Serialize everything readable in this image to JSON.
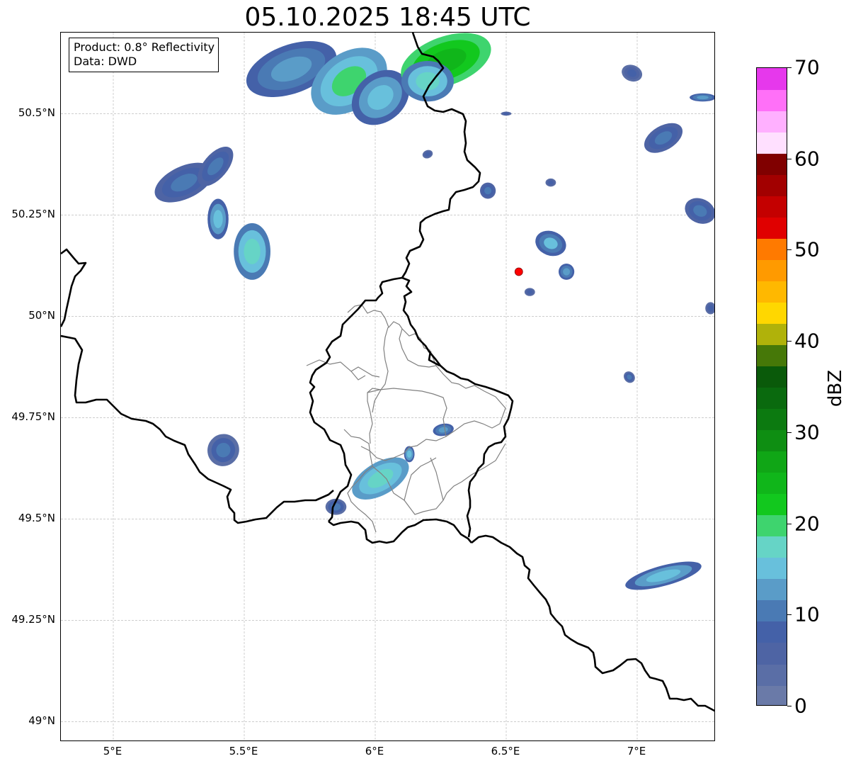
{
  "title": "05.10.2025 18:45 UTC",
  "info": {
    "line1": "Product: 0.8° Reflectivity",
    "line2": "Data: DWD"
  },
  "axes": {
    "x_ticks": [
      {
        "value": 5.0,
        "label": "5°E"
      },
      {
        "value": 5.5,
        "label": "5.5°E"
      },
      {
        "value": 6.0,
        "label": "6°E"
      },
      {
        "value": 6.5,
        "label": "6.5°E"
      },
      {
        "value": 7.0,
        "label": "7°E"
      }
    ],
    "y_ticks": [
      {
        "value": 50.5,
        "label": "50.5°N"
      },
      {
        "value": 50.25,
        "label": "50.25°N"
      },
      {
        "value": 50.0,
        "label": "50°N"
      },
      {
        "value": 49.75,
        "label": "49.75°N"
      },
      {
        "value": 49.5,
        "label": "49.5°N"
      },
      {
        "value": 49.25,
        "label": "49.25°N"
      },
      {
        "value": 49.0,
        "label": "49°N"
      }
    ],
    "lon_range": [
      4.8,
      7.3
    ],
    "lat_range": [
      48.95,
      50.7
    ]
  },
  "colorbar": {
    "label": "dBZ",
    "min": 0,
    "max": 70,
    "ticks": [
      "0",
      "10",
      "20",
      "30",
      "40",
      "50",
      "60",
      "70"
    ],
    "colors": [
      "#6a7aa8",
      "#5a6ea6",
      "#4e64a4",
      "#4461a8",
      "#4a7ab4",
      "#5a9cc8",
      "#68c0dc",
      "#66d4c6",
      "#3ed46e",
      "#12c81e",
      "#10b61a",
      "#10a616",
      "#0e8e12",
      "#0c7a10",
      "#0a6a0e",
      "#0a5a0a",
      "#467808",
      "#b0b20a",
      "#ffd700",
      "#ffb800",
      "#ff9a00",
      "#ff7a00",
      "#e00000",
      "#c40000",
      "#a20000",
      "#800000",
      "#ffe0ff",
      "#ffb0ff",
      "#ff70f8",
      "#e638ec"
    ]
  },
  "radar_site": {
    "lon": 6.548,
    "lat": 50.11,
    "color": "#ff0000"
  },
  "precip_cells": [
    {
      "lon": 5.68,
      "lat": 50.61,
      "rx": 0.18,
      "ry": 0.06,
      "angle": -20,
      "level": 12
    },
    {
      "lon": 5.9,
      "lat": 50.58,
      "rx": 0.16,
      "ry": 0.07,
      "angle": -35,
      "level": 18
    },
    {
      "lon": 6.02,
      "lat": 50.54,
      "rx": 0.12,
      "ry": 0.06,
      "angle": -40,
      "level": 14
    },
    {
      "lon": 6.27,
      "lat": 50.63,
      "rx": 0.18,
      "ry": 0.06,
      "angle": -20,
      "level": 24
    },
    {
      "lon": 6.2,
      "lat": 50.58,
      "rx": 0.1,
      "ry": 0.05,
      "angle": 0,
      "level": 16
    },
    {
      "lon": 5.27,
      "lat": 50.33,
      "rx": 0.12,
      "ry": 0.04,
      "angle": -25,
      "level": 10
    },
    {
      "lon": 5.39,
      "lat": 50.37,
      "rx": 0.09,
      "ry": 0.03,
      "angle": -50,
      "level": 10
    },
    {
      "lon": 5.4,
      "lat": 50.24,
      "rx": 0.04,
      "ry": 0.05,
      "angle": 0,
      "level": 14
    },
    {
      "lon": 5.53,
      "lat": 50.16,
      "rx": 0.07,
      "ry": 0.07,
      "angle": 0,
      "level": 16
    },
    {
      "lon": 5.42,
      "lat": 49.67,
      "rx": 0.06,
      "ry": 0.04,
      "angle": 30,
      "level": 9
    },
    {
      "lon": 6.02,
      "lat": 49.6,
      "rx": 0.12,
      "ry": 0.04,
      "angle": -30,
      "level": 17
    },
    {
      "lon": 5.85,
      "lat": 49.53,
      "rx": 0.04,
      "ry": 0.02,
      "angle": 0,
      "level": 9
    },
    {
      "lon": 6.26,
      "lat": 49.72,
      "rx": 0.04,
      "ry": 0.015,
      "angle": -10,
      "level": 12
    },
    {
      "lon": 6.13,
      "lat": 49.66,
      "rx": 0.02,
      "ry": 0.02,
      "angle": 0,
      "level": 14
    },
    {
      "lon": 6.67,
      "lat": 50.18,
      "rx": 0.06,
      "ry": 0.03,
      "angle": 20,
      "level": 13
    },
    {
      "lon": 6.73,
      "lat": 50.11,
      "rx": 0.03,
      "ry": 0.02,
      "angle": 0,
      "level": 12
    },
    {
      "lon": 6.59,
      "lat": 50.06,
      "rx": 0.02,
      "ry": 0.01,
      "angle": 0,
      "level": 8
    },
    {
      "lon": 6.43,
      "lat": 50.31,
      "rx": 0.03,
      "ry": 0.02,
      "angle": 0,
      "level": 10
    },
    {
      "lon": 6.67,
      "lat": 50.33,
      "rx": 0.02,
      "ry": 0.01,
      "angle": 0,
      "level": 8
    },
    {
      "lon": 6.98,
      "lat": 50.6,
      "rx": 0.04,
      "ry": 0.02,
      "angle": 20,
      "level": 8
    },
    {
      "lon": 7.1,
      "lat": 50.44,
      "rx": 0.08,
      "ry": 0.03,
      "angle": -30,
      "level": 10
    },
    {
      "lon": 7.25,
      "lat": 50.54,
      "rx": 0.05,
      "ry": 0.01,
      "angle": 0,
      "level": 12
    },
    {
      "lon": 7.24,
      "lat": 50.26,
      "rx": 0.06,
      "ry": 0.03,
      "angle": 25,
      "level": 10
    },
    {
      "lon": 7.1,
      "lat": 49.36,
      "rx": 0.15,
      "ry": 0.025,
      "angle": -15,
      "level": 14
    },
    {
      "lon": 6.97,
      "lat": 49.85,
      "rx": 0.02,
      "ry": 0.015,
      "angle": -40,
      "level": 9
    },
    {
      "lon": 7.28,
      "lat": 50.02,
      "rx": 0.02,
      "ry": 0.015,
      "angle": 0,
      "level": 8
    },
    {
      "lon": 6.5,
      "lat": 50.5,
      "rx": 0.02,
      "ry": 0.005,
      "angle": 0,
      "level": 8
    },
    {
      "lon": 6.2,
      "lat": 50.4,
      "rx": 0.02,
      "ry": 0.01,
      "angle": -20,
      "level": 8
    }
  ]
}
